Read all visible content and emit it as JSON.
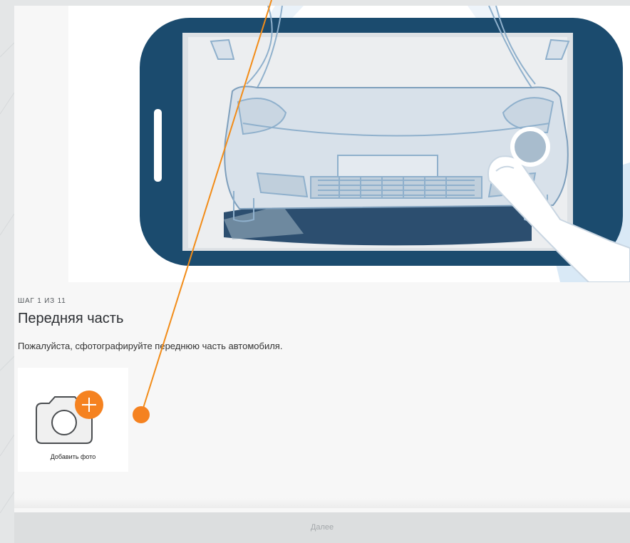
{
  "step": {
    "label": "ШАГ 1 ИЗ 11"
  },
  "title": "Передняя часть",
  "description": "Пожалуйста, сфотографируйте переднюю часть автомобиля.",
  "add_photo": {
    "label": "Добавить фото",
    "icon": "camera-add-icon"
  },
  "footer": {
    "next_label": "Далее"
  },
  "colors": {
    "accent": "#f58220",
    "phone": "#1b4b6e",
    "pointer_line": "#f28c18",
    "car_stroke": "#8fb0cc"
  }
}
